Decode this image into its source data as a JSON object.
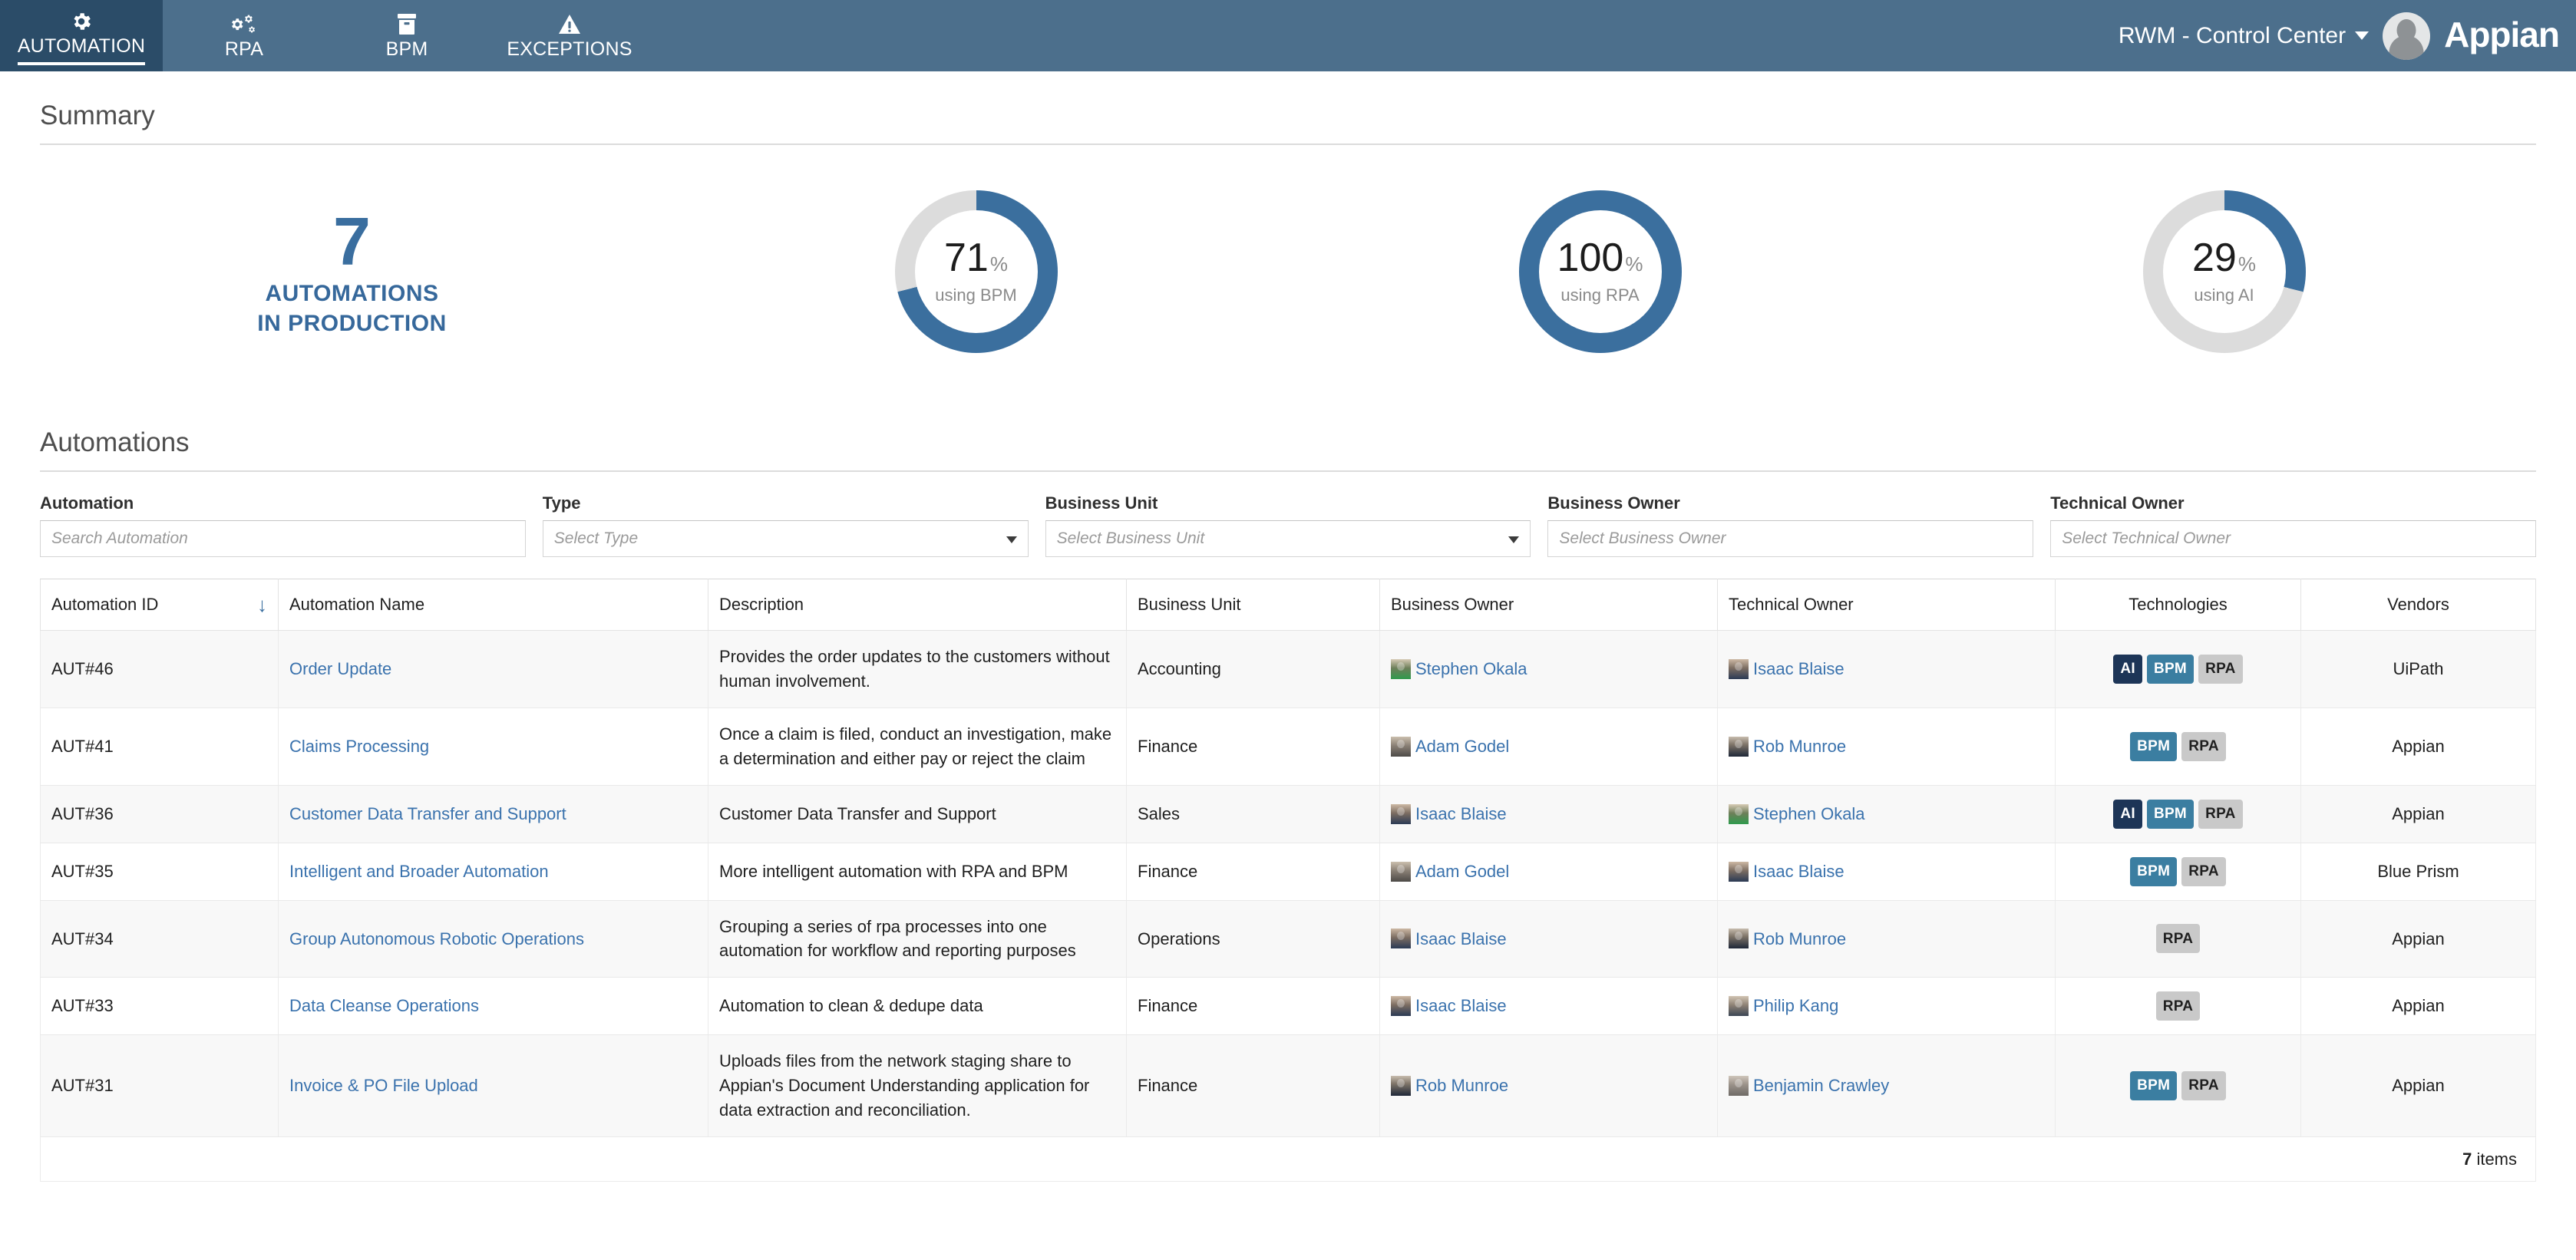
{
  "topnav": {
    "items": [
      {
        "label": "AUTOMATION",
        "icon": "gear-icon",
        "active": true
      },
      {
        "label": "RPA",
        "icon": "gears-icon",
        "active": false
      },
      {
        "label": "BPM",
        "icon": "archive-box-icon",
        "active": false
      },
      {
        "label": "EXCEPTIONS",
        "icon": "warning-triangle-icon",
        "active": false
      }
    ],
    "site_name": "RWM - Control Center",
    "brand": "Appian"
  },
  "summary": {
    "title": "Summary",
    "count": "7",
    "count_label_line1": "AUTOMATIONS",
    "count_label_line2": "IN PRODUCTION"
  },
  "chart_data": [
    {
      "type": "pie",
      "title": "using BPM",
      "categories": [
        "using BPM",
        "remaining"
      ],
      "values": [
        71,
        29
      ],
      "value_label": "71",
      "unit": "%",
      "colors": [
        "#3b6f9e",
        "#dcdcdc"
      ]
    },
    {
      "type": "pie",
      "title": "using RPA",
      "categories": [
        "using RPA",
        "remaining"
      ],
      "values": [
        100,
        0
      ],
      "value_label": "100",
      "unit": "%",
      "colors": [
        "#3b6f9e",
        "#dcdcdc"
      ]
    },
    {
      "type": "pie",
      "title": "using AI",
      "categories": [
        "using AI",
        "remaining"
      ],
      "values": [
        29,
        71
      ],
      "value_label": "29",
      "unit": "%",
      "colors": [
        "#3b6f9e",
        "#dcdcdc"
      ]
    }
  ],
  "automations": {
    "title": "Automations",
    "filters": [
      {
        "label": "Automation",
        "placeholder": "Search Automation",
        "type": "text"
      },
      {
        "label": "Type",
        "placeholder": "Select Type",
        "type": "select"
      },
      {
        "label": "Business Unit",
        "placeholder": "Select Business Unit",
        "type": "select"
      },
      {
        "label": "Business Owner",
        "placeholder": "Select Business Owner",
        "type": "text"
      },
      {
        "label": "Technical Owner",
        "placeholder": "Select Technical Owner",
        "type": "text"
      }
    ],
    "columns": [
      "Automation ID",
      "Automation Name",
      "Description",
      "Business Unit",
      "Business Owner",
      "Technical Owner",
      "Technologies",
      "Vendors"
    ],
    "sort": {
      "column": "Automation ID",
      "direction": "descending",
      "glyph": "↓"
    },
    "rows": [
      {
        "id": "AUT#46",
        "name": "Order Update",
        "description": "Provides the order updates to the customers without human involvement.",
        "business_unit": "Accounting",
        "business_owner": "Stephen Okala",
        "technical_owner": "Isaac Blaise",
        "technologies": [
          "AI",
          "BPM",
          "RPA"
        ],
        "vendor": "UiPath"
      },
      {
        "id": "AUT#41",
        "name": "Claims Processing",
        "description": "Once a claim is filed, conduct an investigation, make a determination and either pay or reject the claim",
        "business_unit": "Finance",
        "business_owner": "Adam Godel",
        "technical_owner": "Rob Munroe",
        "technologies": [
          "BPM",
          "RPA"
        ],
        "vendor": "Appian"
      },
      {
        "id": "AUT#36",
        "name": "Customer Data Transfer and Support",
        "description": "Customer Data Transfer and Support",
        "business_unit": "Sales",
        "business_owner": "Isaac Blaise",
        "technical_owner": "Stephen Okala",
        "technologies": [
          "AI",
          "BPM",
          "RPA"
        ],
        "vendor": "Appian"
      },
      {
        "id": "AUT#35",
        "name": "Intelligent and Broader Automation",
        "description": "More intelligent automation with RPA and BPM",
        "business_unit": "Finance",
        "business_owner": "Adam Godel",
        "technical_owner": "Isaac Blaise",
        "technologies": [
          "BPM",
          "RPA"
        ],
        "vendor": "Blue Prism"
      },
      {
        "id": "AUT#34",
        "name": "Group Autonomous Robotic Operations",
        "description": "Grouping a series of rpa processes into one automation for workflow and reporting purposes",
        "business_unit": "Operations",
        "business_owner": "Isaac Blaise",
        "technical_owner": "Rob Munroe",
        "technologies": [
          "RPA"
        ],
        "vendor": "Appian"
      },
      {
        "id": "AUT#33",
        "name": "Data Cleanse Operations",
        "description": "Automation to clean & dedupe data",
        "business_unit": "Finance",
        "business_owner": "Isaac Blaise",
        "technical_owner": "Philip Kang",
        "technologies": [
          "RPA"
        ],
        "vendor": "Appian"
      },
      {
        "id": "AUT#31",
        "name": "Invoice & PO File Upload",
        "description": "Uploads files from the network staging share to Appian's Document Understanding application for data extraction and reconciliation.",
        "business_unit": "Finance",
        "business_owner": "Rob Munroe",
        "technical_owner": "Benjamin Crawley",
        "technologies": [
          "BPM",
          "RPA"
        ],
        "vendor": "Appian"
      }
    ],
    "footer_count": "7",
    "footer_label": "items"
  },
  "colors": {
    "nav_bg": "#4c6f8c",
    "nav_active_bg": "#2b4c68",
    "accent_blue": "#3a6e9f",
    "link_blue": "#3a72ad",
    "donut_fill": "#3b6f9e",
    "donut_track": "#dcdcdc",
    "tag_ai": "#1d3557",
    "tag_bpm": "#3b7ea1",
    "tag_rpa": "#c9c9c9"
  }
}
